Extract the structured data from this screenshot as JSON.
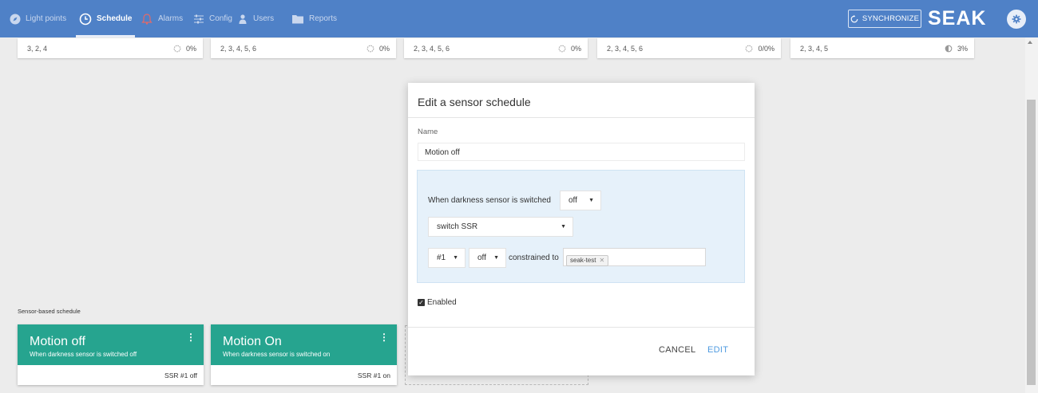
{
  "nav": {
    "items": [
      {
        "label": "Light points",
        "icon": "compass-icon"
      },
      {
        "label": "Schedule",
        "icon": "clock-icon"
      },
      {
        "label": "Alarms",
        "icon": "bell-icon"
      },
      {
        "label": "Config",
        "icon": "sliders-icon"
      },
      {
        "label": "Users",
        "icon": "user-icon"
      },
      {
        "label": "Reports",
        "icon": "folder-icon"
      }
    ],
    "active": "Schedule",
    "sync_label": "SYNCHRONIZE",
    "brand": "SEAK"
  },
  "light_cards": [
    {
      "days": "3, 2, 4",
      "value": "0%"
    },
    {
      "days": "2, 3, 4, 5, 6",
      "value": "0%"
    },
    {
      "days": "2, 3, 4, 5, 6",
      "value": "0%"
    },
    {
      "days": "2, 3, 4, 5, 6",
      "value": "0/0%"
    },
    {
      "days": "2, 3, 4, 5",
      "value": "3%"
    }
  ],
  "sensor_section": {
    "label": "Sensor-based schedule",
    "cards": [
      {
        "title": "Motion off",
        "subtitle": "When darkness sensor is switched off",
        "footer": "SSR #1 off"
      },
      {
        "title": "Motion On",
        "subtitle": "When darkness sensor is switched on",
        "footer": "SSR #1 on"
      }
    ]
  },
  "modal": {
    "title": "Edit a sensor schedule",
    "name_label": "Name",
    "name_value": "Motion off",
    "condition_text": "When darkness sensor is switched",
    "condition_value": "off",
    "action_value": "switch SSR",
    "ssr_value": "#1",
    "state_value": "off",
    "constrained_text": "constrained to",
    "tag": "seak-test",
    "enabled_label": "Enabled",
    "enabled": true,
    "cancel_label": "CANCEL",
    "edit_label": "EDIT"
  },
  "colors": {
    "topbar": "#4f81c7",
    "card_header": "#26a48f",
    "link": "#4f9be0",
    "rule_box": "#e6f1fa"
  }
}
